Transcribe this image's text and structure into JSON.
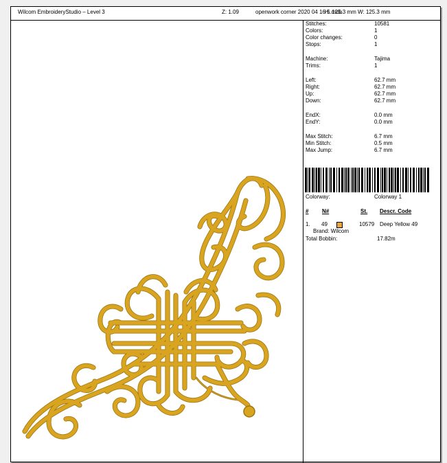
{
  "header": {
    "title": "Wilcom EmbroideryStudio – Level 3",
    "zoom": "Z: 1.09",
    "design_name": "openwork corner 2020 04 16 5.mdb",
    "height": "H: 125.3 mm",
    "width": "W: 125.3 mm"
  },
  "stats": [
    {
      "label": "Stitches:",
      "value": "10581"
    },
    {
      "label": "Colors:",
      "value": "1"
    },
    {
      "label": "Color changes:",
      "value": "0"
    },
    {
      "label": "Stops:",
      "value": "1"
    },
    {
      "label": "Machine:",
      "value": "Tajima"
    },
    {
      "label": "Trims:",
      "value": "1"
    },
    {
      "label": "Left:",
      "value": "62.7 mm"
    },
    {
      "label": "Right:",
      "value": "62.7 mm"
    },
    {
      "label": "Up:",
      "value": "62.7 mm"
    },
    {
      "label": "Down:",
      "value": "62.7 mm"
    },
    {
      "label": "EndX:",
      "value": "0.0 mm"
    },
    {
      "label": "EndY:",
      "value": "0.0 mm"
    },
    {
      "label": "Max Stitch:",
      "value": "6.7 mm"
    },
    {
      "label": "Min Stitch:",
      "value": "0.5 mm"
    },
    {
      "label": "Max Jump:",
      "value": "6.7 mm"
    }
  ],
  "colorway": {
    "label": "Colorway:",
    "value": "Colorway 1"
  },
  "table": {
    "headers": {
      "num": "#",
      "n": "N#",
      "st": "St.",
      "descr": "Descr. Code"
    },
    "rows": [
      {
        "num": "1.",
        "n": "49",
        "swatch_color": "#e8a838",
        "st": "10579",
        "descr": "Deep Yellow 49",
        "brand": "Brand: Wilcom"
      }
    ]
  },
  "bobbin": {
    "label": "Total Bobbin:",
    "value": "17.82m"
  },
  "thread_color": "#d9a520"
}
